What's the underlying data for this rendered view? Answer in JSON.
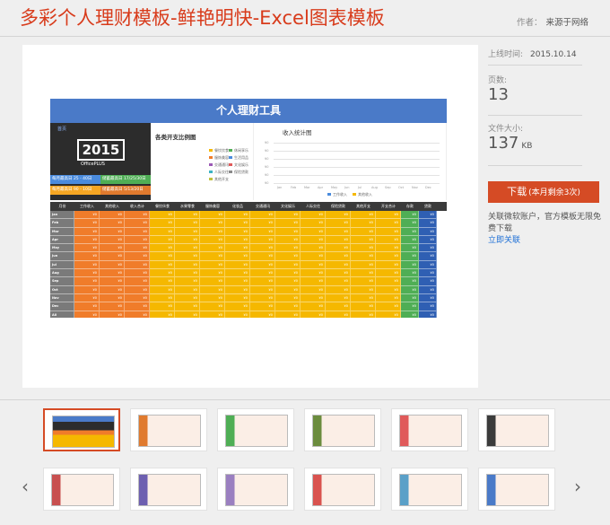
{
  "header": {
    "title": "多彩个人理财模板-鲜艳明快-Excel图表模板",
    "author_label": "作者：",
    "author_value": "来源于网络"
  },
  "sidebar": {
    "upload_label": "上线时间:",
    "upload_value": "2015.10.14",
    "pages_label": "页数:",
    "pages_value": "13",
    "size_label": "文件大小:",
    "size_value": "137",
    "size_unit": "KB",
    "download_label": "下载",
    "download_note": "(本月剩余3次)",
    "notice_text": "关联微软账户，官方模板无限免费下载",
    "notice_link": "立即关联"
  },
  "sheet": {
    "title": "个人理财工具",
    "menu": "首页",
    "year": "2015",
    "year_sub": "OfficePLUS",
    "stats": [
      {
        "label": "每月最高日",
        "value": "25 - 40日",
        "color": "#4a8bdd"
      },
      {
        "label": "储蓄最高日",
        "value": "17/25/30日",
        "color": "#4fae55"
      },
      {
        "label": "每月最高日",
        "value": "90 - 10日",
        "color": "#f5a623"
      },
      {
        "label": "储蓄最高日",
        "value": "5/13/20日",
        "color": "#e07a2e"
      }
    ],
    "pie_title": "各类开支比例图",
    "pie_legend": [
      "餐饮饮食",
      "休闲享乐",
      "服饰美容",
      "生活用品",
      "交通通讯",
      "文化娱乐",
      "人际交往",
      "保险贷款",
      "其他开支"
    ],
    "line_title": "收入统计图",
    "line_legend": [
      "工作收入",
      "其他收入"
    ],
    "line_months": [
      "Jan",
      "Feb",
      "Mar",
      "Apr",
      "May",
      "Jun",
      "Jul",
      "Aug",
      "Sep",
      "Oct",
      "Nov",
      "Dec"
    ],
    "table_headers": [
      "月份",
      "工作收入",
      "其他收入",
      "收入合计",
      "餐饮伙食",
      "水果零食",
      "服饰美容",
      "化妆品",
      "交通通讯",
      "文化娱乐",
      "人际交往",
      "保险贷款",
      "其他开支",
      "开支合计",
      "存款",
      "贷款"
    ],
    "months": [
      "Jan",
      "Feb",
      "Mar",
      "Apr",
      "May",
      "Jun",
      "Jul",
      "Aug",
      "Sep",
      "Oct",
      "Nov",
      "Dec",
      "All"
    ],
    "cell_value": "¥0",
    "colors": {
      "blue": "#4a7ac8",
      "orange": "#f07c2a",
      "yellow": "#f5b800",
      "green": "#4fae55",
      "navy": "#2f5fb3",
      "gray": "#7a7a7a"
    }
  },
  "thumbnails": {
    "row1": [
      "sheet-1",
      "sheet-2",
      "sheet-3",
      "sheet-4",
      "sheet-5",
      "sheet-6"
    ],
    "row2": [
      "sheet-7",
      "sheet-8",
      "sheet-9",
      "sheet-10",
      "sheet-11",
      "sheet-12"
    ],
    "accents": [
      "#333",
      "#e07a2e",
      "#4fae55",
      "#6b8c3e",
      "#e05a5a",
      "#3b3b3b",
      "#c85050",
      "#6d5fb0",
      "#9a7fc0",
      "#d9534f",
      "#5aa0c8",
      "#4a7ac8"
    ]
  },
  "nav": {
    "prev_icon": "chevron-left-icon",
    "next_icon": "chevron-right-icon"
  }
}
